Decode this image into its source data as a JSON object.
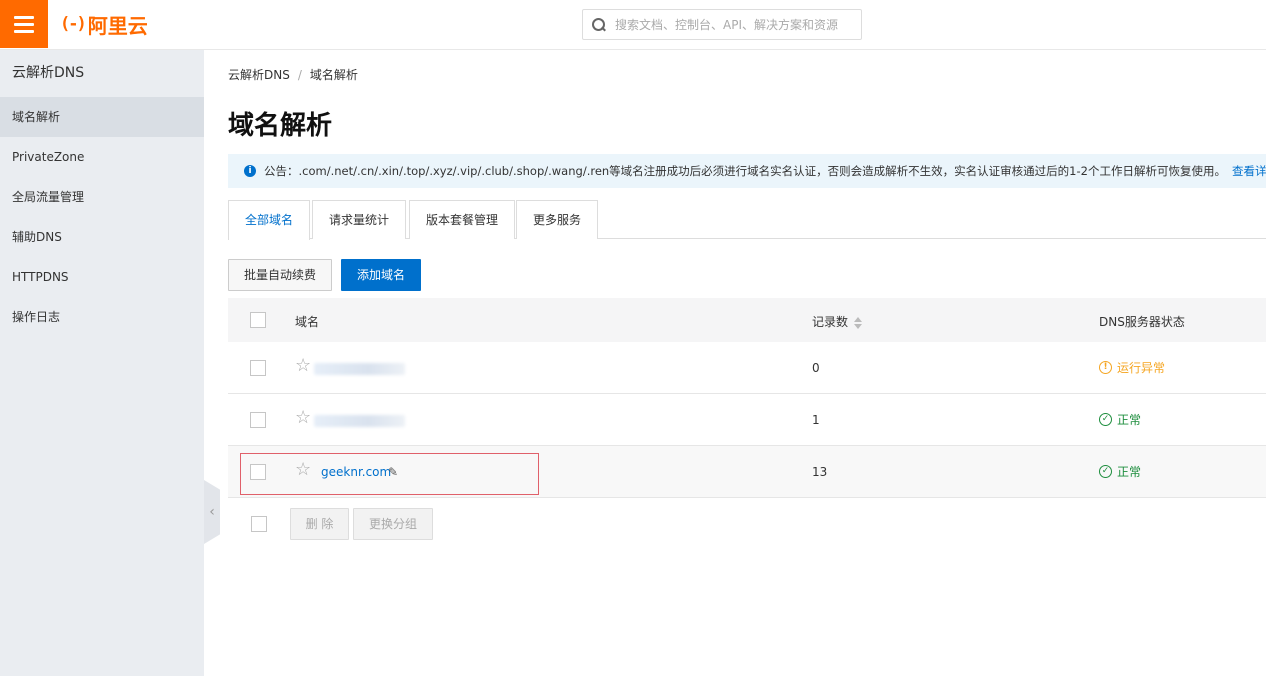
{
  "header": {
    "logo_mark": "(-)",
    "logo_text": "阿里云",
    "search_placeholder": "搜索文档、控制台、API、解决方案和资源"
  },
  "sidebar": {
    "title": "云解析DNS",
    "items": [
      {
        "label": "域名解析",
        "active": true
      },
      {
        "label": "PrivateZone"
      },
      {
        "label": "全局流量管理"
      },
      {
        "label": "辅助DNS"
      },
      {
        "label": "HTTPDNS"
      },
      {
        "label": "操作日志"
      }
    ]
  },
  "breadcrumb": {
    "root": "云解析DNS",
    "separator": "/",
    "current": "域名解析"
  },
  "page_title": "域名解析",
  "notice": {
    "text": "公告：.com/.net/.cn/.xin/.top/.xyz/.vip/.club/.shop/.wang/.ren等域名注册成功后必须进行域名实名认证，否则会造成解析不生效，实名认证审核通过后的1-2个工作日解析可恢复使用。",
    "link": "查看详情"
  },
  "tabs": [
    {
      "label": "全部域名",
      "active": true
    },
    {
      "label": "请求量统计"
    },
    {
      "label": "版本套餐管理"
    },
    {
      "label": "更多服务"
    }
  ],
  "toolbar": {
    "auto_renew_label": "批量自动续费",
    "add_domain_label": "添加域名"
  },
  "table": {
    "columns": {
      "domain": "域名",
      "records": "记录数",
      "dns_status": "DNS服务器状态"
    },
    "rows": [
      {
        "domain": "",
        "records": "0",
        "status": "运行异常",
        "status_type": "warning"
      },
      {
        "domain": "",
        "records": "1",
        "status": "正常",
        "status_type": "ok"
      },
      {
        "domain": "geeknr.com",
        "records": "13",
        "status": "正常",
        "status_type": "ok"
      }
    ]
  },
  "footer_actions": {
    "delete_label": "删 除",
    "change_group_label": "更换分组"
  },
  "icons": {
    "star": "☆",
    "edit": "✎",
    "info": "i",
    "warning": "!",
    "check": "✓",
    "collapse": "‹"
  },
  "colors": {
    "brand": "#ff6a00",
    "primary": "#0070cc",
    "warning": "#f5a623",
    "success": "#1e8e3e",
    "highlight": "#e0606a"
  }
}
